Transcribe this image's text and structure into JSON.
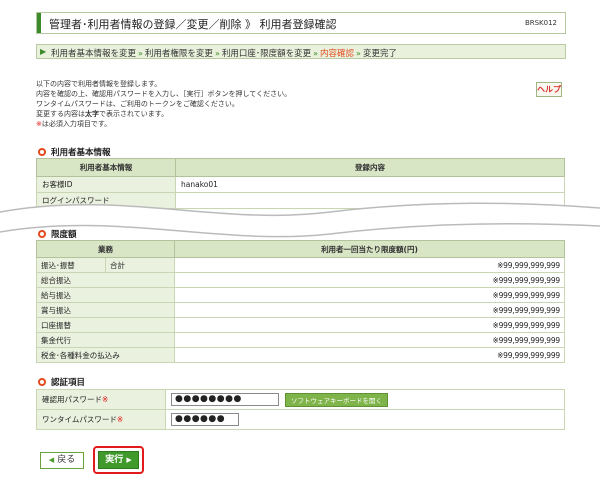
{
  "header": {
    "title": "管理者･利用者情報の登録／変更／削除 》 利用者登録確認",
    "code": "BRSK012"
  },
  "steps": {
    "items": [
      "利用者基本情報を変更",
      "利用者権限を変更",
      "利用口座･限度額を変更",
      "内容確認",
      "変更完了"
    ],
    "separator": "»"
  },
  "intro": {
    "line1": "以下の内容で利用者情報を登録します。",
    "line2": "内容を確認の上、確認用パスワードを入力し、［実行］ボタンを押してください。",
    "line3": "ワンタイムパスワードは、ご利用のトークンをご確認ください。",
    "line4": "変更する内容は",
    "line4_em": "太字",
    "line4_tail": "で表示されています。",
    "line5_mark": "※",
    "line5": "は必須入力項目です。"
  },
  "help_button": {
    "label": "ヘルプ"
  },
  "basic_info": {
    "heading": "利用者基本情報",
    "col1": "利用者基本情報",
    "col2": "登録内容",
    "rows": [
      {
        "label": "お客様ID",
        "value": "hanako01"
      },
      {
        "label": "ログインパスワード",
        "value": ""
      }
    ]
  },
  "limits": {
    "heading": "限度額",
    "col1": "業務",
    "col2": "利用者一回当たり限度額(円)",
    "rows": [
      {
        "label": "振込･振替",
        "sub": "合計",
        "value": "※99,999,999,999"
      },
      {
        "label": "総合振込",
        "sub": "",
        "value": "※999,999,999,999"
      },
      {
        "label": "給与振込",
        "sub": "",
        "value": "※999,999,999,999"
      },
      {
        "label": "賞与振込",
        "sub": "",
        "value": "※999,999,999,999"
      },
      {
        "label": "口座振替",
        "sub": "",
        "value": "※999,999,999,999"
      },
      {
        "label": "集金代行",
        "sub": "",
        "value": "※999,999,999,999"
      },
      {
        "label": "税金･各種料金の払込み",
        "sub": "",
        "value": "※99,999,999,999"
      }
    ]
  },
  "auth": {
    "heading": "認証項目",
    "confirm_pw_label": "確認用パスワード",
    "confirm_pw_value": "●●●●●●●●",
    "keyboard_button": "ソフトウェアキーボードを開く",
    "otp_label": "ワンタイムパスワード",
    "otp_value": "●●●●●●",
    "required_mark": "※"
  },
  "buttons": {
    "back": "戻る",
    "execute": "実行"
  }
}
